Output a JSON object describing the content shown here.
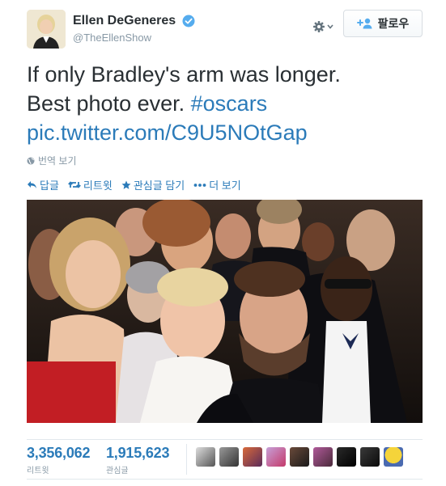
{
  "user": {
    "full_name": "Ellen DeGeneres",
    "screen_name": "@TheEllenShow",
    "verified": true
  },
  "follow_button": {
    "label": "팔로우",
    "icon": "add-user-icon"
  },
  "settings_icon": "gear-icon",
  "tweet": {
    "line1": "If only Bradley's arm was longer.",
    "line2_text": "Best photo ever. ",
    "hashtag": "#oscars",
    "link": "pic.twitter.com/C9U5NOtGap"
  },
  "translate": {
    "label": "번역 보기",
    "icon": "globe-icon"
  },
  "actions": {
    "reply": "답글",
    "retweet": "리트윗",
    "favorite": "관심글 담기",
    "more": "더 보기"
  },
  "stats": {
    "retweets_value": "3,356,062",
    "retweets_label": "리트윗",
    "favorites_value": "1,915,623",
    "favorites_label": "관심글"
  },
  "colors": {
    "link": "#2b7bb9",
    "text": "#292f33",
    "muted": "#8899a6",
    "verified": "#55acee"
  }
}
